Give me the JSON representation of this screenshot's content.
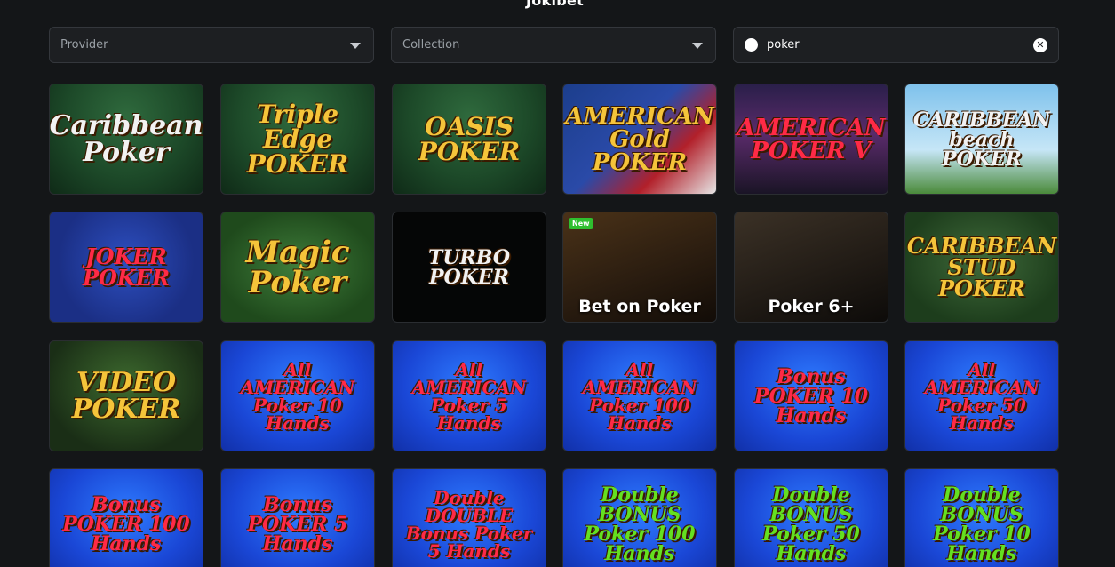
{
  "brand": "Jokibet",
  "filters": {
    "provider_label": "Provider",
    "collection_label": "Collection",
    "search_value": "poker",
    "clear_icon": "clear-icon",
    "search_icon": "search-icon"
  },
  "games": [
    {
      "title": "Caribbean Poker",
      "theme": "g-table",
      "text_class": "white",
      "size": 30
    },
    {
      "title": "Triple Edge POKER",
      "theme": "g-table",
      "text_class": "gold",
      "size": 28
    },
    {
      "title": "OASIS POKER",
      "theme": "g-table",
      "text_class": "gold",
      "size": 28
    },
    {
      "title": "AMERICAN Gold POKER",
      "theme": "g-usa",
      "text_class": "gold",
      "size": 26
    },
    {
      "title": "AMERICAN POKER V",
      "theme": "g-city",
      "text_class": "red",
      "size": 26
    },
    {
      "title": "CARIBBEAN beach POKER",
      "theme": "g-beach",
      "text_class": "white",
      "size": 22
    },
    {
      "title": "JOKER POKER",
      "theme": "g-joker",
      "text_class": "red",
      "size": 24
    },
    {
      "title": "Magic Poker",
      "theme": "g-magic",
      "text_class": "gold",
      "size": 34
    },
    {
      "title": "TURBO POKER",
      "theme": "g-turbo",
      "text_class": "white",
      "size": 22
    },
    {
      "title": "Bet on Poker",
      "theme": "g-live1",
      "live": true,
      "is_new": true
    },
    {
      "title": "Poker 6+",
      "theme": "g-live2",
      "live": true
    },
    {
      "title": "CARIBBEAN STUD POKER",
      "theme": "g-stud",
      "text_class": "gold",
      "size": 24
    },
    {
      "title": "VIDEO POKER",
      "theme": "g-video",
      "text_class": "gold",
      "size": 30
    },
    {
      "title": "All AMERICAN Poker 10 Hands",
      "theme": "g-blue",
      "text_class": "red",
      "size": 20
    },
    {
      "title": "All AMERICAN Poker 5 Hands",
      "theme": "g-blue",
      "text_class": "red",
      "size": 20
    },
    {
      "title": "All AMERICAN Poker 100 Hands",
      "theme": "g-blue",
      "text_class": "red",
      "size": 20
    },
    {
      "title": "Bonus POKER 10 Hands",
      "theme": "g-blue",
      "text_class": "red",
      "size": 22
    },
    {
      "title": "All AMERICAN Poker 50 Hands",
      "theme": "g-blue",
      "text_class": "red",
      "size": 20
    },
    {
      "title": "Bonus POKER 100 Hands",
      "theme": "g-blue",
      "text_class": "red",
      "size": 22
    },
    {
      "title": "Bonus POKER 5 Hands",
      "theme": "g-blue",
      "text_class": "red",
      "size": 22
    },
    {
      "title": "Double DOUBLE Bonus Poker 5 Hands",
      "theme": "g-blue",
      "text_class": "red",
      "size": 20
    },
    {
      "title": "Double BONUS Poker 100 Hands",
      "theme": "g-blue",
      "text_class": "lime",
      "size": 22
    },
    {
      "title": "Double BONUS Poker 50 Hands",
      "theme": "g-blue",
      "text_class": "lime",
      "size": 22
    },
    {
      "title": "Double BONUS Poker 10 Hands",
      "theme": "g-blue",
      "text_class": "lime",
      "size": 22
    }
  ],
  "new_badge": "New"
}
